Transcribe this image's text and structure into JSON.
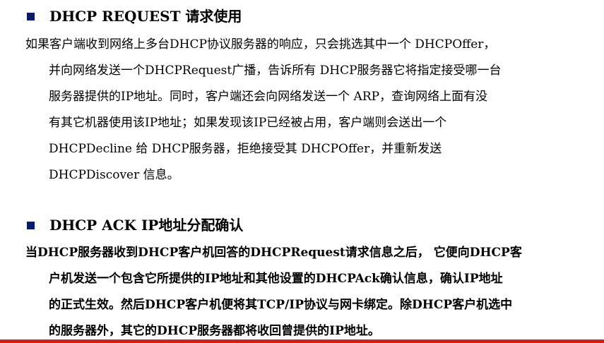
{
  "section1": {
    "heading": "DHCP REQUEST 请求使用",
    "lines": [
      "如果客户端收到网络上多台DHCP协议服务器的响应，只会挑选其中一个 DHCPOffer，",
      "并向网络发送一个DHCPRequest广播，告诉所有 DHCP服务器它将指定接受哪一台",
      "服务器提供的IP地址。同时，客户端还会向网络发送一个 ARP，查询网络上面有没",
      "有其它机器使用该IP地址；如果发现该IP已经被占用，客户端则会送出一个",
      "DHCPDecline 给 DHCP服务器，拒绝接受其 DHCPOffer，并重新发送",
      "DHCPDiscover 信息。"
    ]
  },
  "section2": {
    "heading": "DHCP ACK  IP地址分配确认",
    "lines": [
      "当DHCP服务器收到DHCP客户机回答的DHCPRequest请求信息之后， 它便向DHCP客",
      "户机发送一个包含它所提供的IP地址和其他设置的DHCPAck确认信息，确认IP地址",
      "的正式生效。然后DHCP客户机便将其TCP/IP协议与网卡绑定。除DHCP客户机选中",
      "的服务器外，其它的DHCP服务器都将收回曾提供的IP地址。"
    ]
  },
  "colors": {
    "bullet": "#0b1a66",
    "bottom_rule": "#e01818",
    "text": "#000000"
  }
}
